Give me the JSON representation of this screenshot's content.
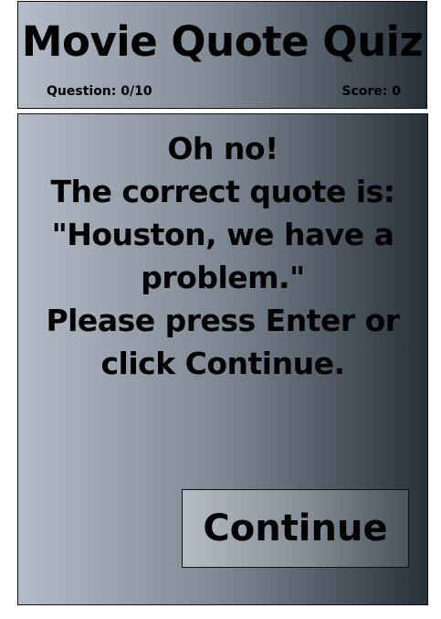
{
  "header": {
    "title": "Movie Quote Quiz",
    "question_counter": "Question: 0/10",
    "score": "Score: 0"
  },
  "feedback": {
    "lines": [
      "Oh no!",
      "The correct quote is:",
      "\"Houston, we have a",
      "problem.\"",
      "Please press Enter or",
      "click Continue."
    ]
  },
  "continue_button": {
    "label": "Continue"
  },
  "colors": {
    "panel_gradient_light": "#b3bcc7",
    "panel_gradient_dark": "#27313a",
    "border": "#111111",
    "text": "#000000"
  }
}
